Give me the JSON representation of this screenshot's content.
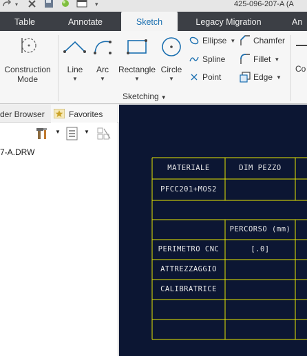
{
  "window": {
    "title": "425-096-207-A (A"
  },
  "quick_access": {
    "icons": [
      "redo-icon",
      "close-window-icon",
      "save-icon",
      "regenerate-icon",
      "window-icon",
      "customize-dropdown-icon"
    ]
  },
  "ribbon_tabs": [
    {
      "label": "Table",
      "active": false
    },
    {
      "label": "Annotate",
      "active": false
    },
    {
      "label": "Sketch",
      "active": true
    },
    {
      "label": "Legacy Migration",
      "active": false
    },
    {
      "label": "An",
      "active": false
    }
  ],
  "ribbon": {
    "construction_mode": {
      "line1": "Construction",
      "line2": "Mode"
    },
    "line": "Line",
    "arc": "Arc",
    "rectangle": "Rectangle",
    "circle": "Circle",
    "ellipse": "Ellipse",
    "spline": "Spline",
    "point": "Point",
    "chamfer": "Chamfer",
    "fillet": "Fillet",
    "edge": "Edge",
    "cut_off": "Co",
    "group_label": "Sketching",
    "accent_color": "#1a6fb0"
  },
  "left_panel": {
    "tabs": [
      {
        "label": "der Browser"
      },
      {
        "label": "Favorites"
      }
    ],
    "filename": "7-A.DRW"
  },
  "drawing": {
    "background_color": "#0c1633",
    "line_color": "#e6e600",
    "headers": [
      "MATERIALE",
      "DIM PEZZO"
    ],
    "material_value": "PFCC201+MOS2",
    "percorso_label": "PERCORSO (mm)",
    "rows": [
      {
        "label": "PERIMETRO CNC",
        "value": "[.0]"
      },
      {
        "label": "ATTREZZAGGIO",
        "value": ""
      },
      {
        "label": "CALIBRATRICE",
        "value": ""
      }
    ]
  }
}
